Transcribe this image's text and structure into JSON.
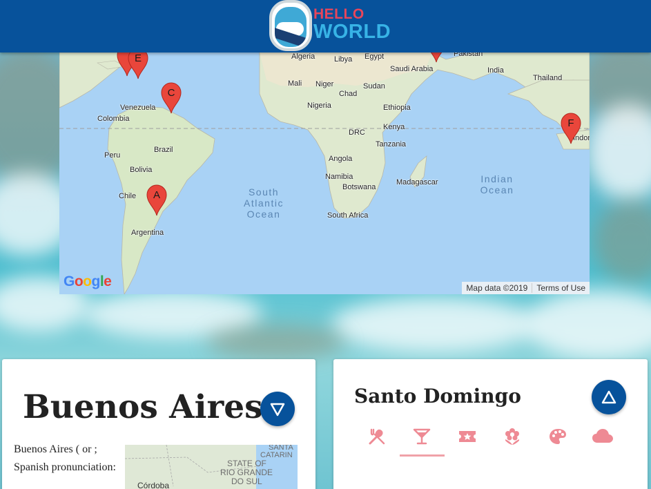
{
  "brand": {
    "hello": "HELLO",
    "world": "WORLD"
  },
  "colors": {
    "header": "#07529b",
    "accent_pink": "#ee8a94",
    "marker_red": "#e9463b",
    "fab_blue": "#07529b"
  },
  "map": {
    "country_labels": [
      "Algeria",
      "Libya",
      "Egypt",
      "Saudi Arabia",
      "Pakistan",
      "India",
      "Thailand",
      "Mali",
      "Niger",
      "Chad",
      "Sudan",
      "Venezuela",
      "Colombia",
      "Nigeria",
      "Ethiopia",
      "DRC",
      "Kenya",
      "Peru",
      "Brazil",
      "Tanzania",
      "Angola",
      "Bolivia",
      "Madagascar",
      "Namibia",
      "Botswana",
      "Chile",
      "South Africa",
      "Argentina",
      "Indone"
    ],
    "ocean_labels": [
      "South Atlantic Ocean",
      "Indian Ocean"
    ],
    "markers": [
      "A",
      "C",
      "E",
      "F"
    ],
    "google_logo": "Google",
    "attribution": {
      "data": "Map data ©2019",
      "terms": "Terms of Use"
    }
  },
  "cards": {
    "left": {
      "title": "Buenos Aires",
      "description": "Buenos Aires ( or ; Spanish pronunciation:",
      "thumb_labels": {
        "state": "STATE OF",
        "line2": "SANTA",
        "line3": "CATARIN",
        "line4": "RIO GRANDE",
        "line5": "DO SUL",
        "city": "Córdoba"
      },
      "toggle_icon": "triangle-down-icon"
    },
    "right": {
      "title": "Santo Domingo",
      "toggle_icon": "triangle-up-icon",
      "tabs": [
        {
          "icon": "utensils-icon",
          "active": false
        },
        {
          "icon": "cocktail-icon",
          "active": true
        },
        {
          "icon": "ticket-star-icon",
          "active": false
        },
        {
          "icon": "flower-icon",
          "active": false
        },
        {
          "icon": "palette-icon",
          "active": false
        },
        {
          "icon": "cloud-icon",
          "active": false
        }
      ]
    }
  }
}
